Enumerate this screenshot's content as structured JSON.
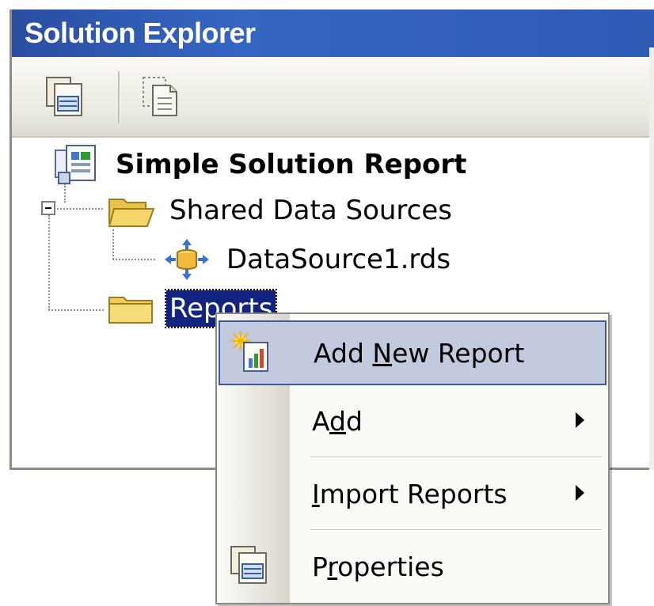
{
  "window": {
    "title": "Solution Explorer"
  },
  "toolbar": {
    "buttons": [
      {
        "icon": "properties-icon"
      },
      {
        "icon": "show-all-files-icon"
      }
    ]
  },
  "tree": {
    "solution": {
      "label": "Simple Solution Report",
      "icon": "solution-icon"
    },
    "shared_data_sources": {
      "label": "Shared Data Sources",
      "icon": "open-folder-icon",
      "expanded": true
    },
    "datasource": {
      "label": "DataSource1.rds",
      "icon": "data-source-icon"
    },
    "reports": {
      "label": "Reports",
      "icon": "folder-icon",
      "selected": true
    }
  },
  "context_menu": {
    "items": [
      {
        "label_pre": "Add ",
        "accel": "N",
        "label_post": "ew Report",
        "icon": "add-new-report-icon",
        "highlighted": true,
        "submenu": false
      },
      {
        "label_pre": "A",
        "accel": "d",
        "label_post": "d",
        "submenu": true
      },
      {
        "label_pre": "",
        "accel": "I",
        "label_post": "mport Reports",
        "submenu": true
      },
      {
        "label_pre": "P",
        "accel": "r",
        "label_post": "operties",
        "icon": "properties-icon",
        "submenu": false
      }
    ]
  },
  "colors": {
    "title_bar": "#2e5ab4",
    "selection": "#12247f",
    "menu_highlight": "#c3cadf",
    "menu_highlight_border": "#3f5ba0"
  }
}
